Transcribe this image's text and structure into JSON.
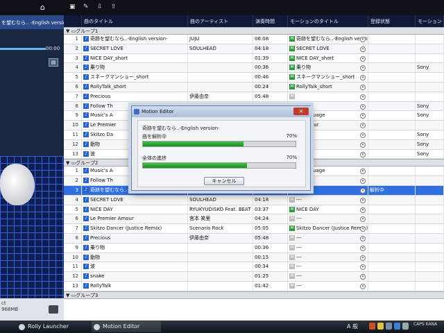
{
  "window": {
    "remaining_label": "968MB",
    "status_prefix": "ct",
    "left_title": "を望むなら.. -English versio",
    "time_display": "00:00"
  },
  "columns": {
    "title": "曲のタイトル",
    "artist": "曲のアーティスト",
    "duration": "演奏時間",
    "motion_title": "モーションのタイトル",
    "register_state": "登録状態",
    "extra": "モーション"
  },
  "groups": [
    {
      "name": "グループ1",
      "rows": [
        {
          "n": "1",
          "title": "奇跡を望むなら..-English version-",
          "artist": "JUJU",
          "time": "06:08",
          "motion": "奇跡を望むなら..-English version",
          "motion_on": true,
          "state": "",
          "extra": ""
        },
        {
          "n": "2",
          "title": "SECRET LOVE",
          "artist": "SOULHEAD",
          "time": "04:18",
          "motion": "SECRET LOVE",
          "motion_on": true,
          "state": "",
          "extra": ""
        },
        {
          "n": "3",
          "title": "NICE DAY_short",
          "artist": "",
          "time": "01:39",
          "motion": "NICE DAY_short",
          "motion_on": true,
          "state": "",
          "extra": ""
        },
        {
          "n": "4",
          "title": "乗り物",
          "artist": "",
          "time": "00:36",
          "motion": "乗り物",
          "motion_on": true,
          "state": "",
          "extra": "Sony"
        },
        {
          "n": "5",
          "title": "スネークマンショー_short",
          "artist": "",
          "time": "00:46",
          "motion": "スネークマンショー_short",
          "motion_on": true,
          "state": "",
          "extra": ""
        },
        {
          "n": "6",
          "title": "RollyTalk_short",
          "artist": "",
          "time": "00:24",
          "motion": "RollyTalk_short",
          "motion_on": true,
          "state": "",
          "extra": ""
        },
        {
          "n": "7",
          "title": "Precious",
          "artist": "伊藤由奈",
          "time": "05:48",
          "motion": "",
          "motion_on": false,
          "state": "",
          "extra": ""
        },
        {
          "n": "8",
          "title": "Follow Th",
          "artist": "",
          "time": "",
          "motion": "hrough",
          "motion_on": false,
          "state": "",
          "extra": "Sony"
        },
        {
          "n": "9",
          "title": "Music's A",
          "artist": "",
          "time": "",
          "motion": "A Language",
          "motion_on": false,
          "state": "",
          "extra": "Sony"
        },
        {
          "n": "10",
          "title": "Le Premier",
          "artist": "",
          "time": "",
          "motion": "er Amour",
          "motion_on": false,
          "state": "",
          "extra": ""
        },
        {
          "n": "11",
          "title": "Skitzo Da",
          "artist": "",
          "time": "",
          "motion": "ancer",
          "motion_on": false,
          "state": "",
          "extra": "Sony"
        },
        {
          "n": "12",
          "title": "動物",
          "artist": "",
          "time": "",
          "motion": "",
          "motion_on": false,
          "state": "",
          "extra": "Sony"
        },
        {
          "n": "13",
          "title": "波",
          "artist": "",
          "time": "",
          "motion": "",
          "motion_on": false,
          "state": "",
          "extra": "Sony"
        }
      ]
    },
    {
      "name": "グループ2",
      "rows": [
        {
          "n": "1",
          "title": "Music's A",
          "artist": "",
          "time": "",
          "motion": "A Language",
          "motion_on": false,
          "state": "",
          "extra": ""
        },
        {
          "n": "2",
          "title": "Follow Th",
          "artist": "",
          "time": "",
          "motion": "hrough",
          "motion_on": false,
          "state": "",
          "extra": ""
        },
        {
          "n": "3",
          "title": "奇跡を望むなら..-English version-",
          "artist": "JUJU",
          "time": "06:08",
          "motion": "---",
          "motion_on": false,
          "state": "解析中",
          "extra": "",
          "selected": true
        },
        {
          "n": "4",
          "title": "SECRET LOVE",
          "artist": "SOULHEAD",
          "time": "04:18",
          "motion": "---",
          "motion_on": false,
          "state": "",
          "extra": ""
        },
        {
          "n": "5",
          "title": "NICE DAY",
          "artist": "RYUKYUDISKO Feat. BEAT",
          "time": "03:37",
          "motion": "NICE DAY",
          "motion_on": true,
          "state": "",
          "extra": ""
        },
        {
          "n": "6",
          "title": "Le Premier Amour",
          "artist": "宮本 笑里",
          "time": "04:24",
          "motion": "---",
          "motion_on": false,
          "state": "",
          "extra": ""
        },
        {
          "n": "7",
          "title": "Skitzo Dancer (Justice Remix)",
          "artist": "Scenario Rock",
          "time": "05:05",
          "motion": "Skitzo Dancer (Justice Remix)",
          "motion_on": true,
          "state": "",
          "extra": ""
        },
        {
          "n": "8",
          "title": "Precious",
          "artist": "伊藤由奈",
          "time": "05:48",
          "motion": "---",
          "motion_on": false,
          "state": "",
          "extra": ""
        },
        {
          "n": "9",
          "title": "乗り物",
          "artist": "",
          "time": "00:36",
          "motion": "---",
          "motion_on": false,
          "state": "",
          "extra": ""
        },
        {
          "n": "10",
          "title": "動物",
          "artist": "",
          "time": "00:15",
          "motion": "---",
          "motion_on": false,
          "state": "",
          "extra": ""
        },
        {
          "n": "11",
          "title": "波",
          "artist": "",
          "time": "00:34",
          "motion": "---",
          "motion_on": false,
          "state": "",
          "extra": ""
        },
        {
          "n": "12",
          "title": "snake",
          "artist": "",
          "time": "01:25",
          "motion": "---",
          "motion_on": false,
          "state": "",
          "extra": ""
        },
        {
          "n": "13",
          "title": "RollyTalk",
          "artist": "",
          "time": "01:42",
          "motion": "---",
          "motion_on": false,
          "state": "",
          "extra": ""
        }
      ]
    },
    {
      "name": "グループ3",
      "rows": []
    }
  ],
  "dialog": {
    "title": "Motion Editor",
    "close_glyph": "✕",
    "song": "奇跡を望むなら..-English version-",
    "task1_label": "曲を解析中",
    "task1_pct": "70%",
    "task1_progress": 0.66,
    "task2_label": "全体の進捗",
    "task2_pct": "70%",
    "task2_progress": 0.68,
    "cancel_label": "キャンセル"
  },
  "taskbar": {
    "items": [
      "Rolly Launcher",
      "Motion Editor"
    ],
    "ime": "A 般",
    "clock": "CAPS KANA"
  },
  "colors": {
    "accent": "#2f6fe0",
    "progress": "#2ba534",
    "header": "#0f1a3a"
  }
}
